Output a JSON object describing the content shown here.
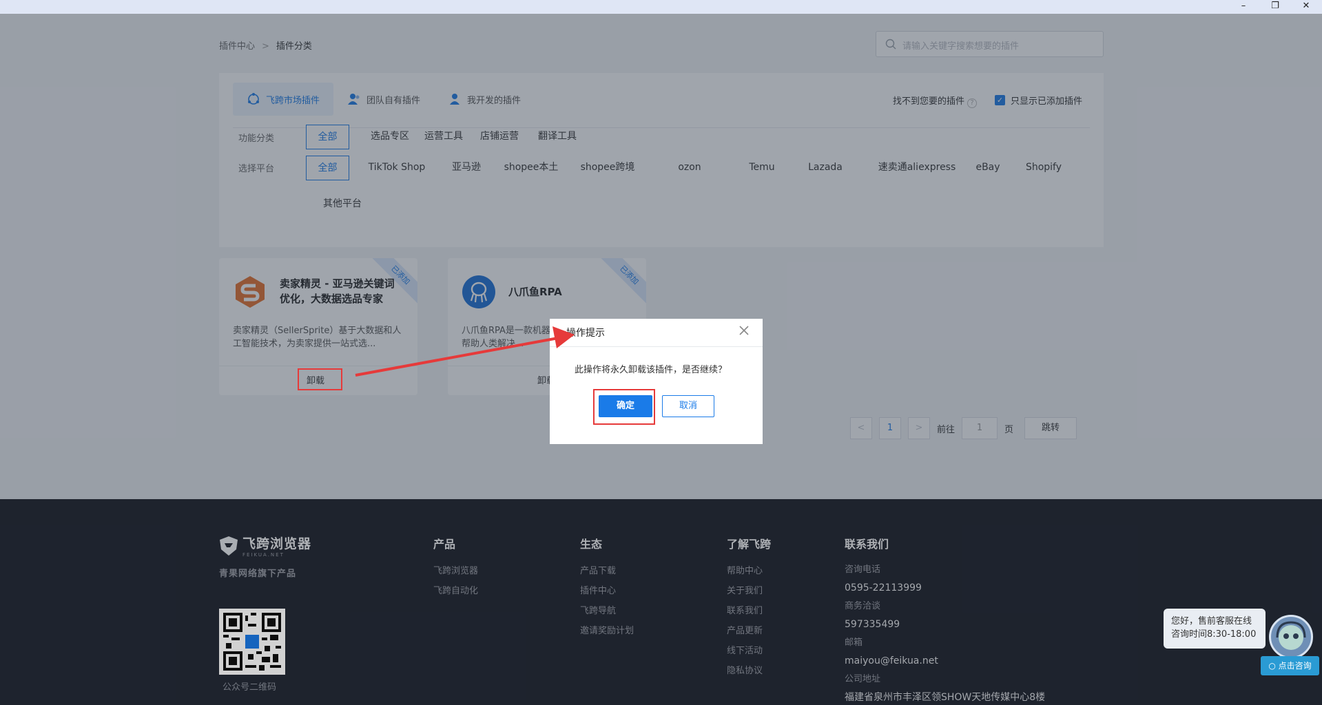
{
  "window": {
    "minimize": "–",
    "restore": "❐",
    "close": "✕"
  },
  "breadcrumb": {
    "root": "插件中心",
    "separator": ">",
    "current": "插件分类"
  },
  "search": {
    "placeholder": "请输入关键字搜索想要的插件",
    "icon": "search-icon"
  },
  "source_tabs": [
    {
      "label": "飞跨市场插件",
      "icon": "market-icon",
      "active": true
    },
    {
      "label": "团队自有插件",
      "icon": "team-icon",
      "active": false
    },
    {
      "label": "我开发的插件",
      "icon": "developer-icon",
      "active": false
    }
  ],
  "find_link": {
    "label": "找不到您要的插件",
    "help": "?"
  },
  "only_added": {
    "label": "只显示已添加插件",
    "checked": true,
    "check": "✓"
  },
  "filters": {
    "function_label": "功能分类",
    "function_options": [
      "全部",
      "选品专区",
      "运营工具",
      "店铺运营",
      "翻译工具"
    ],
    "platform_label": "选择平台",
    "platform_options": [
      "全部",
      "TikTok Shop",
      "亚马逊",
      "shopee本土",
      "shopee跨境",
      "ozon",
      "Temu",
      "Lazada",
      "速卖通aliexpress",
      "eBay",
      "Shopify",
      "其他平台"
    ]
  },
  "cards": [
    {
      "title": "卖家精灵 - 亚马逊关键词优化，大数据选品专家",
      "desc": "卖家精灵（SellerSprite）基于大数据和人工智能技术，为卖家提供一站式选...",
      "ribbon": "已添加",
      "action": "卸载"
    },
    {
      "title": "八爪鱼RPA",
      "desc": "八爪鱼RPA是一款机器人流程自动化软件，帮助人类解决...",
      "ribbon": "已添加",
      "action": "卸载"
    }
  ],
  "pagination": {
    "prev": "<",
    "page": "1",
    "next": ">",
    "goto": "前往",
    "input": "1",
    "unit": "页",
    "jump": "跳转"
  },
  "dialog": {
    "title": "操作提示",
    "message": "此操作将永久卸载该插件，是否继续？",
    "confirm": "确定",
    "cancel": "取消"
  },
  "footer": {
    "logo_name": "飞跨浏览器",
    "logo_sub": "FEIKUA.NET",
    "slogan": "青果网络旗下产品",
    "qr_caption": "公众号二维码",
    "columns": [
      {
        "title": "产品",
        "links": [
          "飞跨浏览器",
          "飞跨自动化"
        ]
      },
      {
        "title": "生态",
        "links": [
          "产品下载",
          "插件中心",
          "飞跨导航",
          "邀请奖励计划"
        ]
      },
      {
        "title": "了解飞跨",
        "links": [
          "帮助中心",
          "关于我们",
          "联系我们",
          "产品更新",
          "线下活动",
          "隐私协议"
        ]
      }
    ],
    "contact": {
      "title": "联系我们",
      "phone_label": "咨询电话",
      "phone": "0595-22113999",
      "biz_label": "商务洽谈",
      "biz": "597335499",
      "email_label": "邮箱",
      "email": "maiyou@feikua.net",
      "address_label": "公司地址",
      "address": "福建省泉州市丰泽区领SHOW天地传媒中心8楼"
    }
  },
  "chat": {
    "line1": "您好，售前客服在线",
    "line2": "咨询时间8:30-18:00",
    "button": "点击咨询"
  },
  "colors": {
    "accent": "#1a7be8",
    "highlight": "#e63a3a",
    "footer_bg": "#252b38"
  }
}
